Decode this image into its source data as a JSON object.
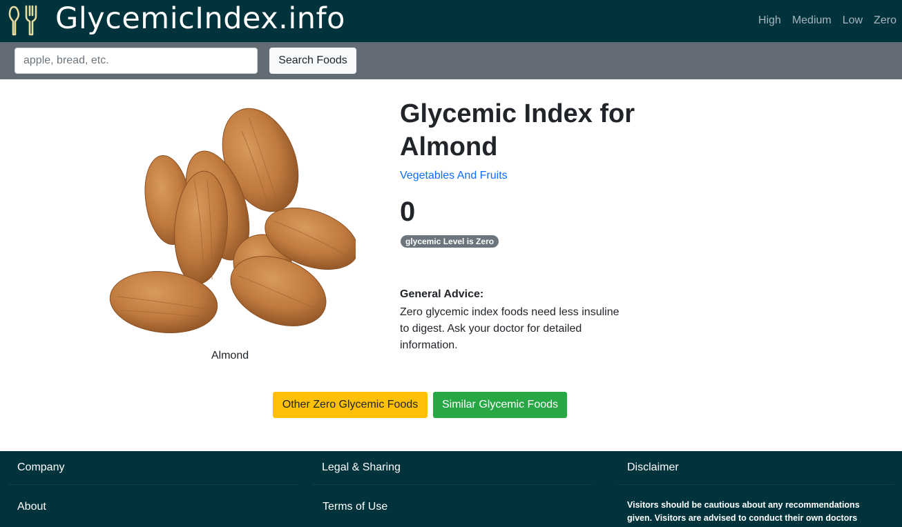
{
  "header": {
    "brand": "GlycemicIndex.info",
    "logo_icon": "spoon-fork-icon",
    "nav": [
      "High",
      "Medium",
      "Low",
      "Zero"
    ]
  },
  "search": {
    "placeholder": "apple, bread, etc.",
    "value": "",
    "button_label": "Search Foods"
  },
  "food": {
    "image_icon": "almond-image",
    "caption": "Almond",
    "title": "Glycemic Index for Almond",
    "category": "Vegetables And Fruits",
    "gi_value": "0",
    "level_badge": "glycemic Level is Zero",
    "advice_title": "General Advice:",
    "advice_text": "Zero glycemic index foods need less insuline to digest. Ask your doctor for detailed information."
  },
  "actions": {
    "other_label": "Other Zero Glycemic Foods",
    "similar_label": "Similar Glycemic Foods"
  },
  "footer": {
    "col1_title": "Company",
    "col1_link": "About",
    "col2_title": "Legal & Sharing",
    "col2_link": "Terms of Use",
    "col3_title": "Disclaimer",
    "col3_text": "Visitors should be cautious about any recommendations given. Visitors are advised to conduct their own doctors"
  },
  "colors": {
    "header_bg": "#01333c",
    "searchbar_bg": "#636b75",
    "link": "#0d6efd",
    "badge": "#6c757d",
    "warning": "#ffc107",
    "success": "#28a745"
  }
}
